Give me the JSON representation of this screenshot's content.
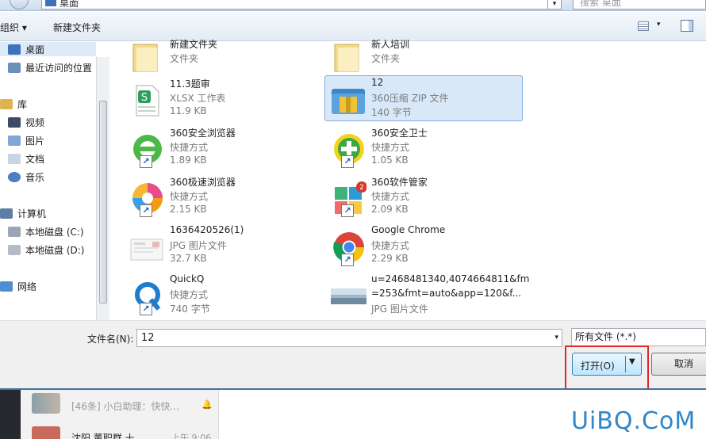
{
  "address": {
    "path": "桌面",
    "search_placeholder": "搜索 桌面"
  },
  "toolbar": {
    "organize": "组织 ▾",
    "new_folder": "新建文件夹",
    "view_drop": "▾"
  },
  "nav": {
    "desktop": "桌面",
    "recent": "最近访问的位置",
    "libraries": "库",
    "videos": "视频",
    "pictures": "图片",
    "documents": "文档",
    "music": "音乐",
    "computer": "计算机",
    "disk_c": "本地磁盘 (C:)",
    "disk_d": "本地磁盘 (D:)",
    "network": "网络"
  },
  "files": [
    {
      "name": "新建文件夹",
      "type": "文件夹",
      "size": ""
    },
    {
      "name": "新人培训",
      "type": "文件夹",
      "size": ""
    },
    {
      "name": "11.3题审",
      "type": "XLSX 工作表",
      "size": "11.9 KB"
    },
    {
      "name": "12",
      "type": "360压缩 ZIP 文件",
      "size": "140 字节"
    },
    {
      "name": "360安全浏览器",
      "type": "快捷方式",
      "size": "1.89 KB"
    },
    {
      "name": "360安全卫士",
      "type": "快捷方式",
      "size": "1.05 KB"
    },
    {
      "name": "360极速浏览器",
      "type": "快捷方式",
      "size": "2.15 KB"
    },
    {
      "name": "360软件管家",
      "type": "快捷方式",
      "size": "2.09 KB"
    },
    {
      "name": "1636420526(1)",
      "type": "JPG 图片文件",
      "size": "32.7 KB"
    },
    {
      "name": "Google Chrome",
      "type": "快捷方式",
      "size": "2.29 KB"
    },
    {
      "name": "QuickQ",
      "type": "快捷方式",
      "size": "740 字节"
    },
    {
      "name": "u=2468481340,4074664811&fm",
      "name2": "=253&fmt=auto&app=120&f...",
      "type": "JPG 图片文件"
    }
  ],
  "bottom": {
    "filename_label": "文件名(N):",
    "filename_value": "12",
    "filter_value": "所有文件 (*.*)",
    "open_label": "打开(O)",
    "cancel_label": "取消",
    "dropdown_arrow": "▾"
  },
  "chat": {
    "row1": "[46条] 小白助理：快快...",
    "row2": "沈阳 董职群 十",
    "row2_time": "上午 9:06"
  },
  "watermark": "UiBQ.CoM",
  "colors": {
    "selection": "#d9e8f9",
    "highlight_box": "#e0282a",
    "accent": "#3c7fb1"
  }
}
